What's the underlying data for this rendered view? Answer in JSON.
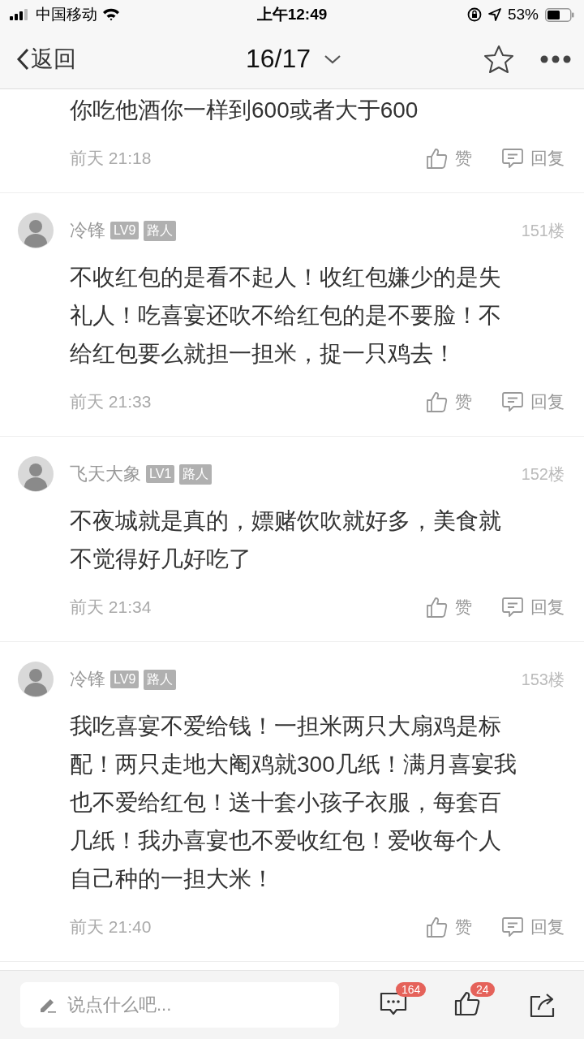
{
  "status_bar": {
    "carrier": "中国移动",
    "time": "上午12:49",
    "battery": "53%"
  },
  "nav": {
    "back": "返回",
    "title": "16/17"
  },
  "partial_comment": {
    "text": "你吃他酒你一样到600或者大于600",
    "time": "前天 21:18",
    "like": "赞",
    "reply": "回复"
  },
  "comments": [
    {
      "author": "冷锋",
      "level": "LV9",
      "role": "路人",
      "floor": "151楼",
      "text": "不收红包的是看不起人！收红包嫌少的是失礼人！吃喜宴还吹不给红包的是不要脸！不给红包要么就担一担米，捉一只鸡去！",
      "time": "前天 21:33",
      "like": "赞",
      "reply": "回复"
    },
    {
      "author": "飞天大象",
      "level": "LV1",
      "role": "路人",
      "floor": "152楼",
      "text": "不夜城就是真的，嫖赌饮吹就好多，美食就不觉得好几好吃了",
      "time": "前天 21:34",
      "like": "赞",
      "reply": "回复"
    },
    {
      "author": "冷锋",
      "level": "LV9",
      "role": "路人",
      "floor": "153楼",
      "text": "我吃喜宴不爱给钱！一担米两只大扇鸡是标配！两只走地大阉鸡就300几纸！满月喜宴我也不爱给红包！送十套小孩子衣服，每套百几纸！我办喜宴也不爱收红包！爱收每个人自己种的一担大米！",
      "time": "前天 21:40",
      "like": "赞",
      "reply": "回复"
    }
  ],
  "bottom_bar": {
    "placeholder": "说点什么吧...",
    "comment_count": "164",
    "like_count": "24"
  }
}
